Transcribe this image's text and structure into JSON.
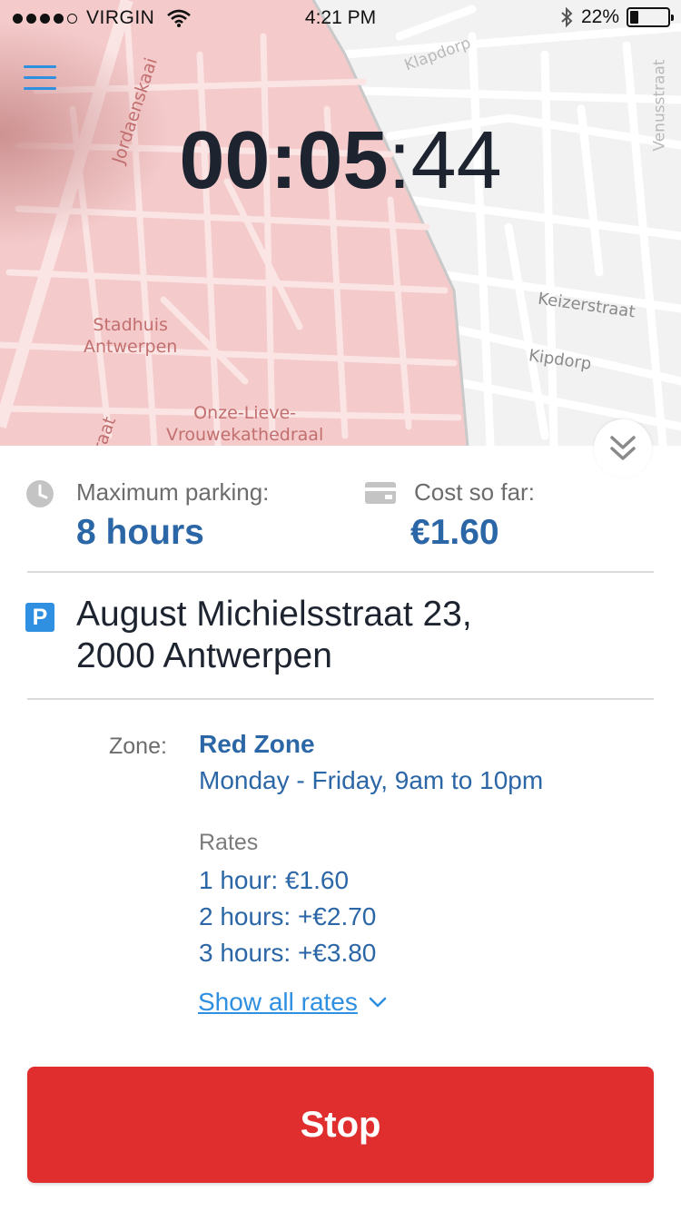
{
  "status_bar": {
    "carrier": "VIRGIN",
    "time": "4:21 PM",
    "battery_text": "22%",
    "battery_level": 0.22,
    "icons": [
      "signal-dots",
      "wifi-icon",
      "bluetooth-icon",
      "battery-icon"
    ]
  },
  "map": {
    "labels": {
      "stadhuis_1": "Stadhuis",
      "stadhuis_2": "Antwerpen",
      "kathedraal_1": "Onze-Lieve-",
      "kathedraal_2": "Vrouwekathedraal",
      "jordaenskaai": "Jordaenskaai",
      "klapdorp": "Klapdorp",
      "venusstraat": "Venusstraat",
      "keizerstraat": "Keizerstraat",
      "kipdorp": "Kipdorp",
      "edge_label": "raat"
    },
    "zone_color": "#f3c9c9"
  },
  "timer": {
    "hours_minutes": "00:05",
    "seconds": ":44"
  },
  "summary": {
    "max_parking_label": "Maximum parking:",
    "max_parking_value": "8 hours",
    "cost_label": "Cost so far:",
    "cost_value": "€1.60"
  },
  "location": {
    "line1": "August Michielsstraat 23,",
    "line2": "2000 Antwerpen",
    "icon_letter": "P"
  },
  "zone": {
    "label": "Zone:",
    "name": "Red Zone",
    "hours": "Monday - Friday, 9am to 10pm",
    "rates_label": "Rates",
    "rates": [
      "1 hour: €1.60",
      "2 hours: +€2.70",
      "3 hours: +€3.80"
    ],
    "show_all_label": "Show all rates"
  },
  "actions": {
    "stop_label": "Stop"
  },
  "colors": {
    "accent_blue": "#2f8fe0",
    "value_blue": "#2b66a6",
    "stop_red": "#e02e2e"
  }
}
